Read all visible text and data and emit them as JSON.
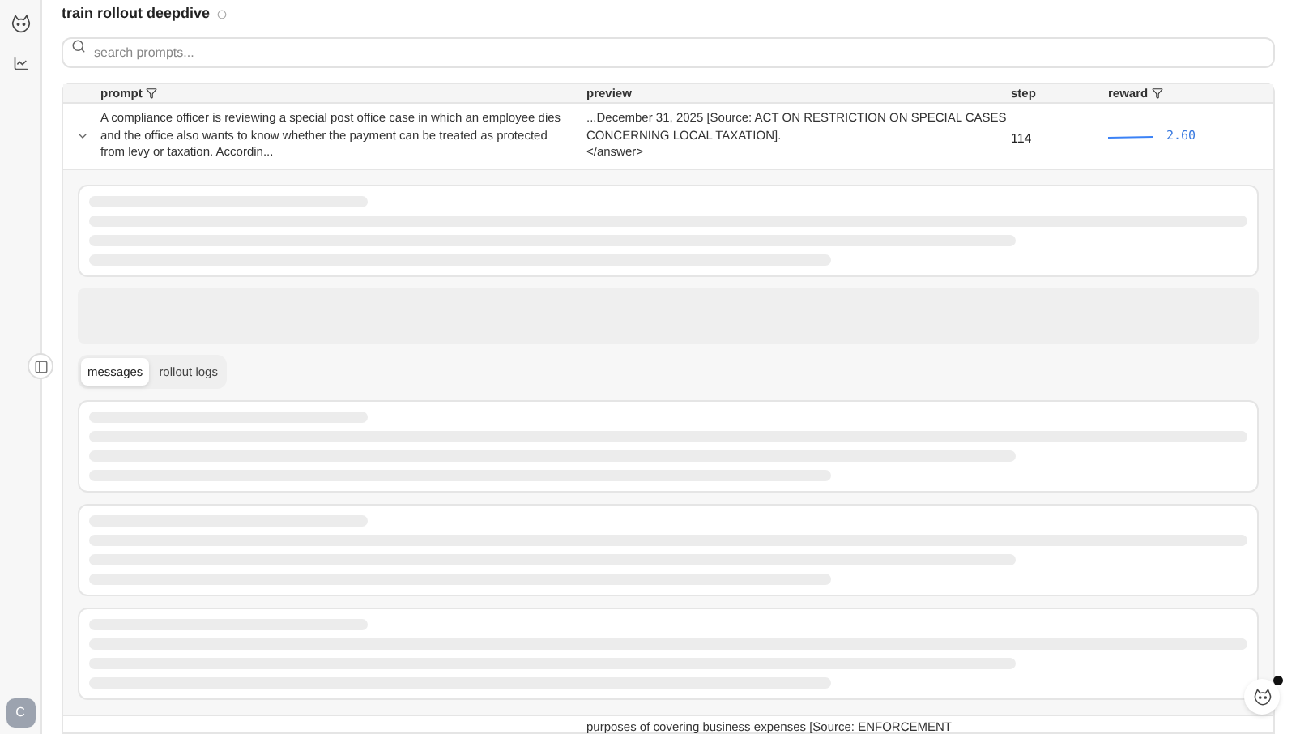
{
  "page": {
    "title": "train rollout deepdive"
  },
  "search": {
    "placeholder": "search prompts..."
  },
  "table": {
    "columns": [
      {
        "label": "prompt",
        "filter": true
      },
      {
        "label": "preview",
        "filter": false
      },
      {
        "label": "step",
        "filter": false
      },
      {
        "label": "reward",
        "filter": true
      }
    ],
    "rows": [
      {
        "expanded": true,
        "prompt": "A compliance officer is reviewing a special post office case in which an employee dies and the office also wants to know whether the payment can be treated as protected from levy or taxation. Accordin...",
        "preview_lines": [
          "...December 31, 2025 [Source: ACT ON RESTRICTION ON SPECIAL CASES CONCERNING LOCAL TAXATION].",
          "</answer>"
        ],
        "step": "114",
        "reward": "2.60"
      },
      {
        "expanded": false,
        "preview_lines": [
          "purposes of covering business expenses [Source: ENFORCEMENT"
        ]
      }
    ]
  },
  "detail_tabs": [
    {
      "label": "messages",
      "selected": true
    },
    {
      "label": "rollout logs",
      "selected": false
    }
  ],
  "user": {
    "initial": "C"
  }
}
